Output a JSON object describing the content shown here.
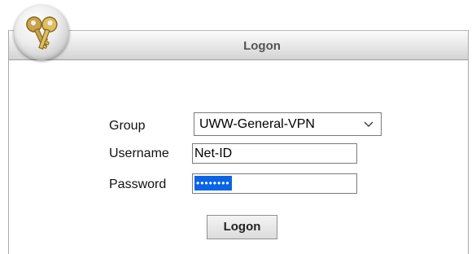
{
  "window": {
    "title": "Logon",
    "logo_icon": "keys-icon"
  },
  "form": {
    "group_label": "Group",
    "group_value": "UWW-General-VPN",
    "group_options": [
      "UWW-General-VPN"
    ],
    "username_label": "Username",
    "username_value": "Net-ID",
    "password_label": "Password",
    "password_value": "••••••••",
    "submit_label": "Logon"
  },
  "colors": {
    "selection_highlight": "#0a64e6",
    "titlebar_text": "#555555"
  }
}
